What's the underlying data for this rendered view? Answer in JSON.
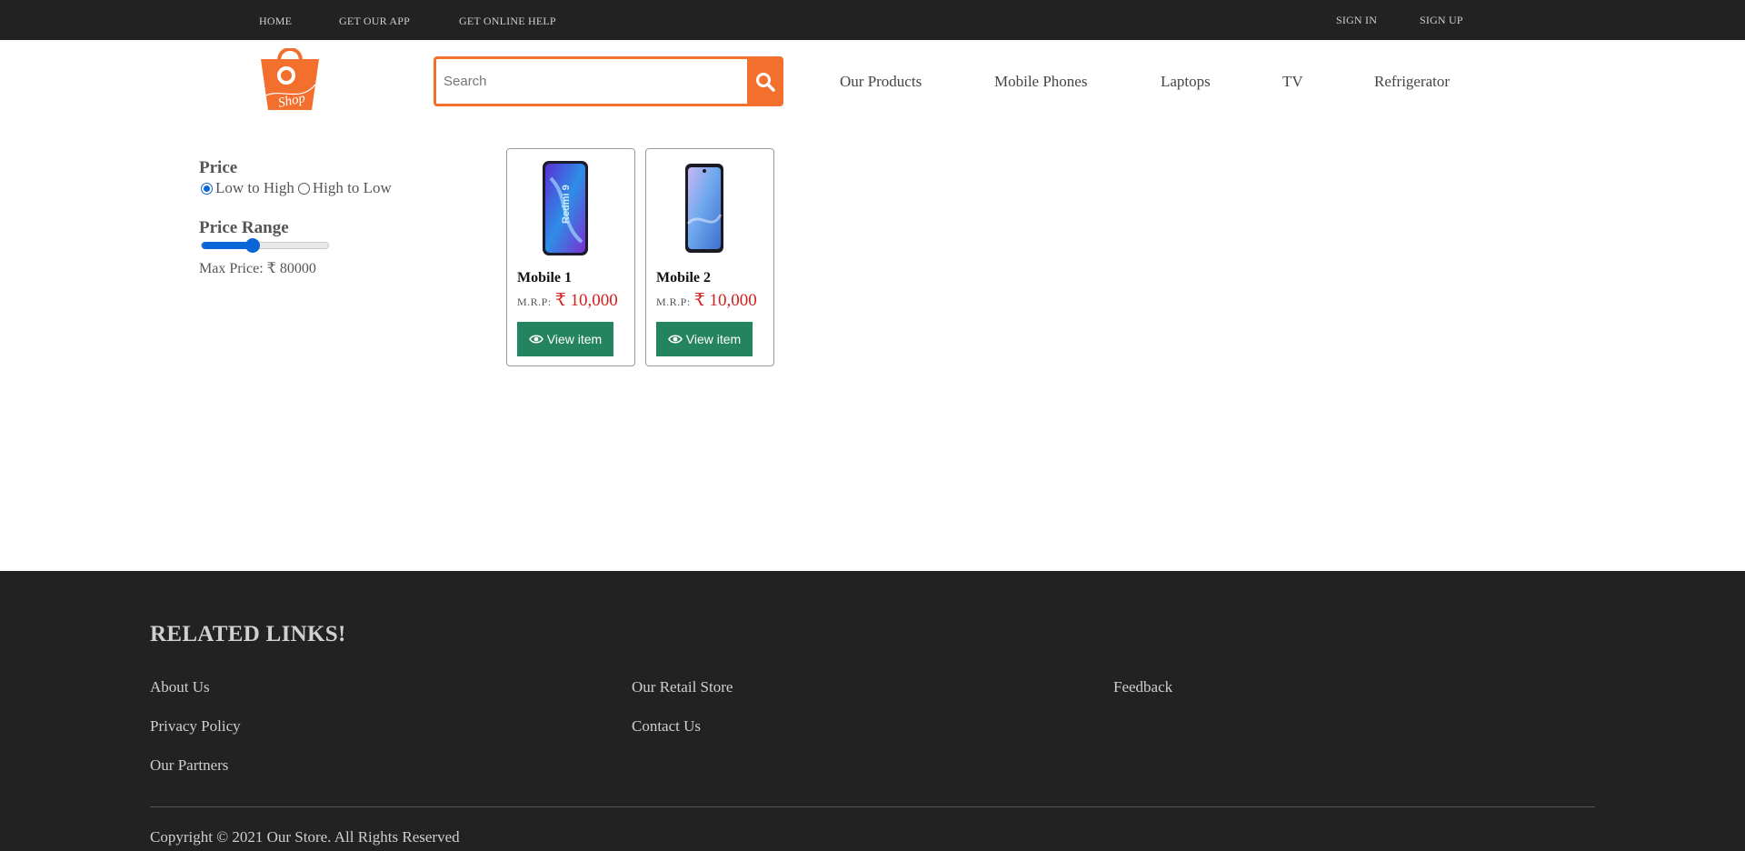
{
  "topbar": {
    "home": "HOME",
    "get_app": "GET OUR APP",
    "help": "GET ONLINE HELP",
    "sign_in": "SIGN IN",
    "sign_up": "SIGN UP"
  },
  "logo": {
    "icon": "shopping-bag-icon",
    "text": "Shop",
    "color": "#f36f2e"
  },
  "search": {
    "placeholder": "Search",
    "value": "",
    "icon": "search-icon",
    "accent": "#f36f2e"
  },
  "nav": [
    "Our Products",
    "Mobile Phones",
    "Laptops",
    "TV",
    "Refrigerator"
  ],
  "filters": {
    "price_title": "Price",
    "sort_options": [
      "Low to High",
      "High to Low"
    ],
    "selected_sort": "Low to High",
    "range_title": "Price Range",
    "range_fraction": 0.4,
    "max_price_label": "Max Price: ₹ 80000"
  },
  "products": [
    {
      "name": "Mobile 1",
      "mrp_label": "M.R.P:",
      "price": "₹ 10,000",
      "button": "View item"
    },
    {
      "name": "Mobile 2",
      "mrp_label": "M.R.P:",
      "price": "₹ 10,000",
      "button": "View item"
    }
  ],
  "footer": {
    "title": "RELATED LINKS!",
    "links": [
      "About Us",
      "Privacy Policy",
      "Our Partners",
      "Our Retail Store",
      "Contact Us",
      "Feedback"
    ],
    "copyright": "Copyright © 2021 Our Store. All Rights Reserved"
  },
  "colors": {
    "topbar": "#222222",
    "accent": "#f36f2e",
    "button": "#24845f",
    "price": "#d41f1f",
    "radio": "#0a66d6"
  }
}
